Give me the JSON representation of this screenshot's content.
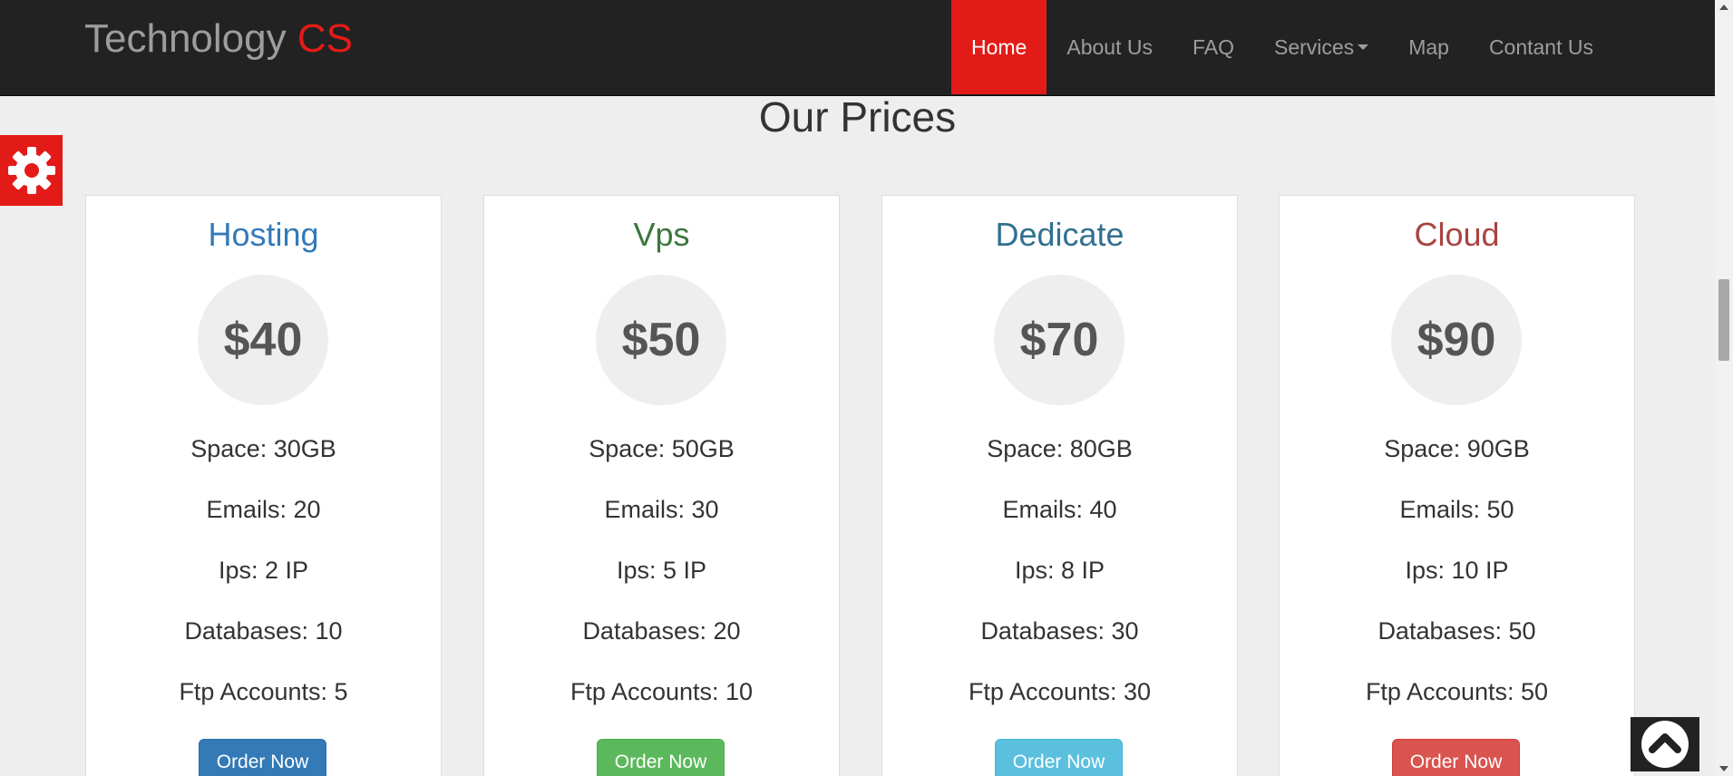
{
  "brand": {
    "text": "Technology",
    "accent": "CS"
  },
  "nav": {
    "items": [
      {
        "label": "Home",
        "active": true
      },
      {
        "label": "About Us"
      },
      {
        "label": "FAQ"
      },
      {
        "label": "Services"
      },
      {
        "label": "Map"
      },
      {
        "label": "Contant Us"
      }
    ]
  },
  "section": {
    "title": "Our Prices"
  },
  "plans": [
    {
      "name": "Hosting",
      "price": "$40",
      "features": [
        "Space: 30GB",
        "Emails: 20",
        "Ips: 2 IP",
        "Databases: 10",
        "Ftp Accounts: 5"
      ],
      "button": "Order Now"
    },
    {
      "name": "Vps",
      "price": "$50",
      "features": [
        "Space: 50GB",
        "Emails: 30",
        "Ips: 5 IP",
        "Databases: 20",
        "Ftp Accounts: 10"
      ],
      "button": "Order Now"
    },
    {
      "name": "Dedicate",
      "price": "$70",
      "features": [
        "Space: 80GB",
        "Emails: 40",
        "Ips: 8 IP",
        "Databases: 30",
        "Ftp Accounts: 30"
      ],
      "button": "Order Now"
    },
    {
      "name": "Cloud",
      "price": "$90",
      "features": [
        "Space: 90GB",
        "Emails: 50",
        "Ips: 10 IP",
        "Databases: 50",
        "Ftp Accounts: 50"
      ],
      "button": "Order Now"
    }
  ],
  "colors": {
    "accent": "#e31b18",
    "navbar": "#222222",
    "hosting": "#337ab7",
    "vps": "#3c763d",
    "dedicate": "#31708f",
    "cloud": "#a94442",
    "btn_primary": "#337ab7",
    "btn_success": "#5cb85c",
    "btn_info": "#5bc0de",
    "btn_danger": "#d9534f"
  },
  "icons": {
    "settings": "gear-icon",
    "scroll_top": "chevron-up-circle-icon"
  }
}
